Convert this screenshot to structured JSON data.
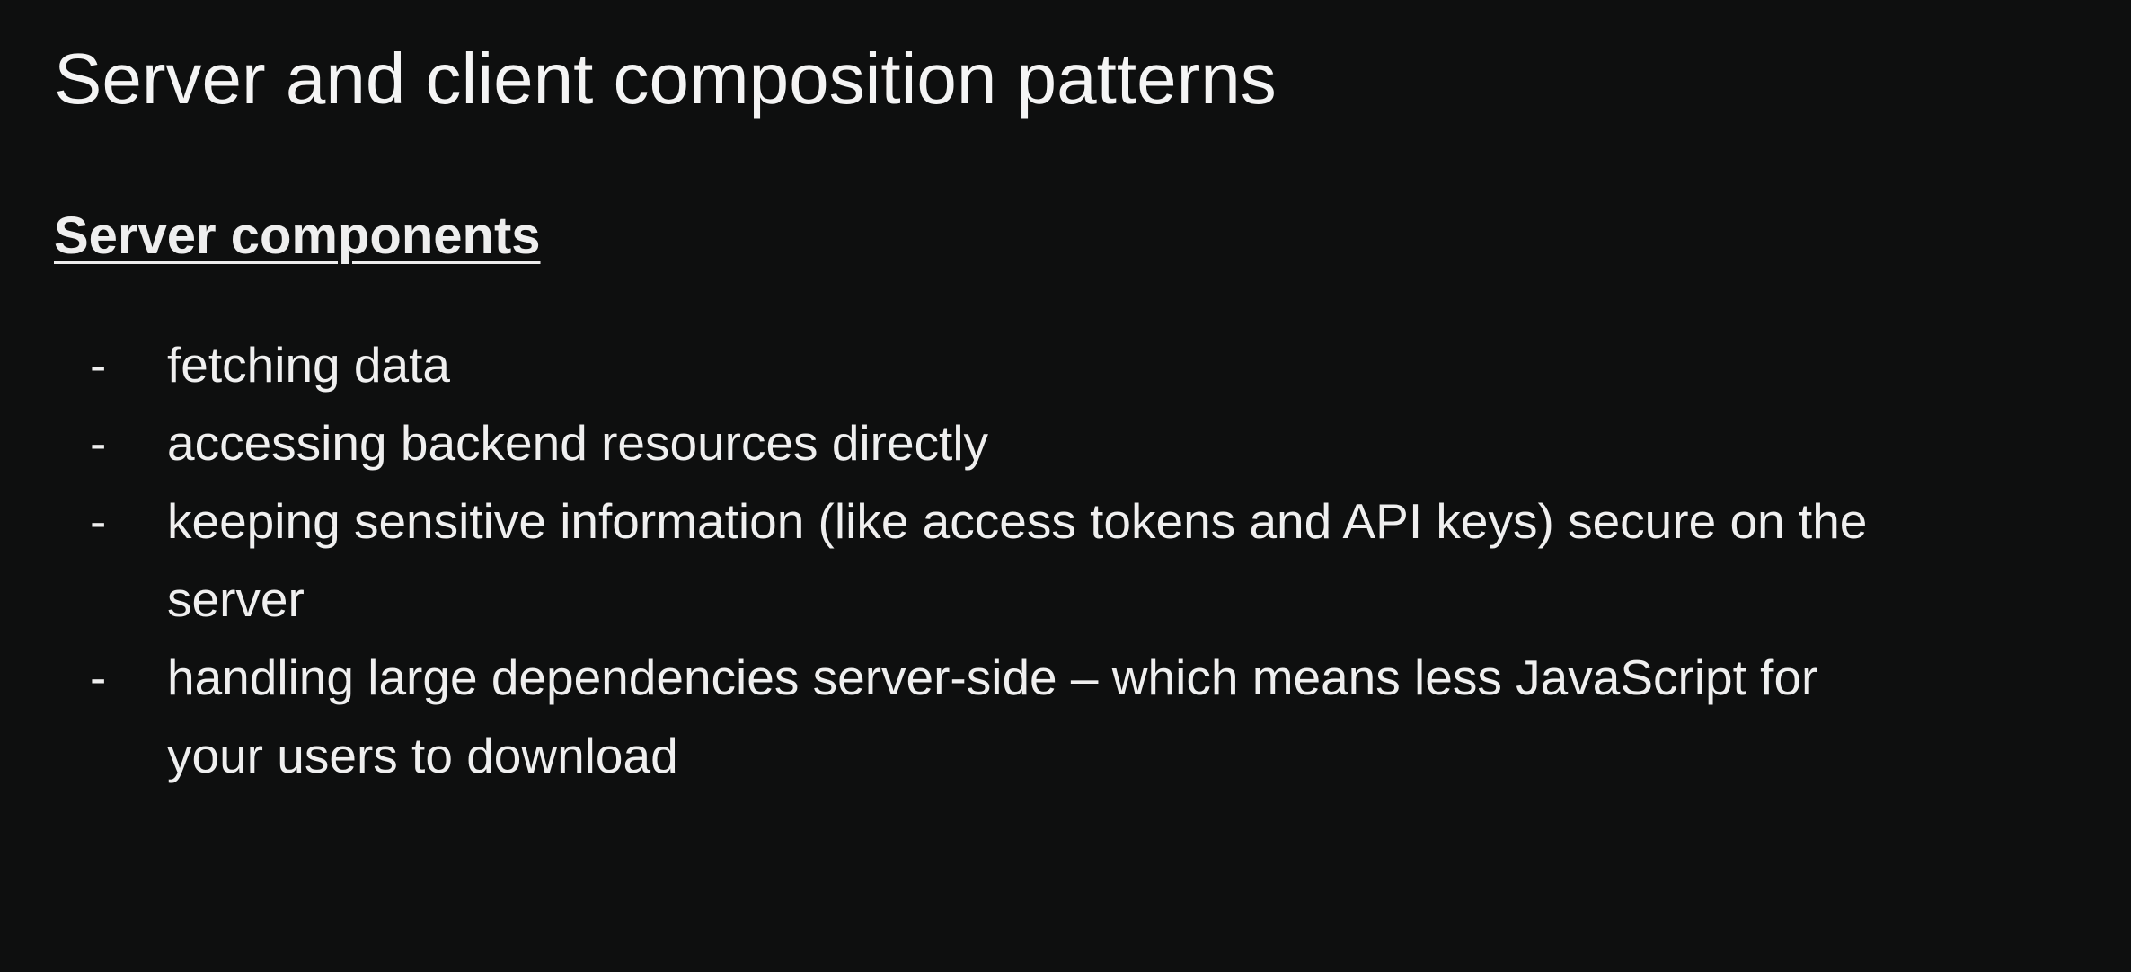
{
  "slide": {
    "title": "Server and client composition patterns",
    "section_heading": "Server components",
    "bullet_marker": "-",
    "bullets": [
      {
        "lines": [
          "fetching data"
        ]
      },
      {
        "lines": [
          "accessing backend resources directly"
        ]
      },
      {
        "lines": [
          "keeping sensitive information (like access tokens and API keys) secure on the",
          "server"
        ]
      },
      {
        "lines": [
          "handling large dependencies server-side – which means less JavaScript for",
          "your users to download"
        ]
      }
    ]
  },
  "colors": {
    "background": "#0e0f0f",
    "text": "#f2f2f2"
  }
}
